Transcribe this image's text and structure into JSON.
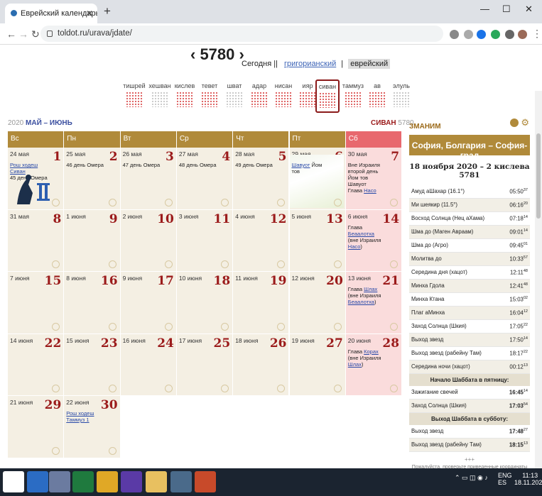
{
  "browser": {
    "tab_title": "Еврейский календарь и конвер",
    "url": "toldot.ru/urava/jdate/"
  },
  "year_nav": {
    "year": "‹ 5780 ›",
    "today": "Сегодня",
    "sep": "||",
    "gregorian": "григорианский",
    "sep2": "|",
    "hebrew": "еврейский"
  },
  "months": [
    "тишрей",
    "хешван",
    "кислев",
    "тевет",
    "шват",
    "адар",
    "нисан",
    "ияр",
    "сиван",
    "таммуз",
    "ав",
    "элуль"
  ],
  "month_header": {
    "g_year": "2020",
    "g_months": "МАЙ – ИЮНЬ",
    "h_month": "СИВАН",
    "h_year": "5780"
  },
  "weekdays": [
    "Вс",
    "Пн",
    "Вт",
    "Ср",
    "Чт",
    "Пт",
    "Сб"
  ],
  "weeks": [
    [
      {
        "d": "24 мая",
        "n": "1",
        "t": "Рош ходеш Сиван",
        "t2": "45 день Омера"
      },
      {
        "d": "25 мая",
        "n": "2",
        "t2": "46 день Омера"
      },
      {
        "d": "26 мая",
        "n": "3",
        "t2": "47 день Омера"
      },
      {
        "d": "27 мая",
        "n": "4",
        "t2": "48 день Омера"
      },
      {
        "d": "28 мая",
        "n": "5",
        "t2": "49 день Омера"
      },
      {
        "d": "29 мая",
        "n": "6",
        "t": "Шавуот",
        "t2": " Йом тов"
      },
      {
        "d": "30 мая",
        "n": "7",
        "t2": "Вне Израиля второй день Йом тов Шавуот",
        "t3": "Глава ",
        "t": "Насо"
      }
    ],
    [
      {
        "d": "31 мая",
        "n": "8"
      },
      {
        "d": "1 июня",
        "n": "9"
      },
      {
        "d": "2 июня",
        "n": "10"
      },
      {
        "d": "3 июня",
        "n": "11"
      },
      {
        "d": "4 июня",
        "n": "12"
      },
      {
        "d": "5 июня",
        "n": "13"
      },
      {
        "d": "6 июня",
        "n": "14",
        "t3": "Глава ",
        "t": "Беаалотха",
        "t4": "(вне Израиля ",
        "t5": "Насо",
        "t6": ")"
      }
    ],
    [
      {
        "d": "7 июня",
        "n": "15"
      },
      {
        "d": "8 июня",
        "n": "16"
      },
      {
        "d": "9 июня",
        "n": "17"
      },
      {
        "d": "10 июня",
        "n": "18"
      },
      {
        "d": "11 июня",
        "n": "19"
      },
      {
        "d": "12 июня",
        "n": "20"
      },
      {
        "d": "13 июня",
        "n": "21",
        "t3": "Глава ",
        "t": "Шлах",
        "t4": "(вне Израиля ",
        "t5": "Беаалотха",
        "t6": ")"
      }
    ],
    [
      {
        "d": "14 июня",
        "n": "22"
      },
      {
        "d": "15 июня",
        "n": "23"
      },
      {
        "d": "16 июня",
        "n": "24"
      },
      {
        "d": "17 июня",
        "n": "25"
      },
      {
        "d": "18 июня",
        "n": "26"
      },
      {
        "d": "19 июня",
        "n": "27"
      },
      {
        "d": "20 июня",
        "n": "28",
        "t3": "Глава ",
        "t": "Корах",
        "t4": "(вне Израиля ",
        "t5": "Шлах",
        "t6": ")"
      }
    ],
    [
      {
        "d": "21 июня",
        "n": "29"
      },
      {
        "d": "22 июня",
        "n": "30",
        "t": "Рош ходеш Таммуз 1"
      }
    ]
  ],
  "zmanim": {
    "title": "ЗМАНИМ",
    "location": "София, Болгария – София-град",
    "date": "18 ноября 2020 – 2 кислева 5781",
    "rows": [
      {
        "name": "Амуд аШахар (16.1°)",
        "time": "05:50",
        "sec": "37"
      },
      {
        "name": "Ми шеякир (11.5°)",
        "time": "06:16",
        "sec": "20"
      },
      {
        "name": "Восход Солнца (Нец аХама)",
        "time": "07:18",
        "sec": "14"
      },
      {
        "name": "Шма до (Маген Авраам)",
        "time": "09:01",
        "sec": "14"
      },
      {
        "name": "Шма до (Агро)",
        "time": "09:45",
        "sec": "01"
      },
      {
        "name": "Молитва до",
        "time": "10:33",
        "sec": "57"
      },
      {
        "name": "Середина дня (хацот)",
        "time": "12:11",
        "sec": "48"
      },
      {
        "name": "Минха Гдола",
        "time": "12:41",
        "sec": "48"
      },
      {
        "name": "Минха Ктана",
        "time": "15:03",
        "sec": "02"
      },
      {
        "name": "Плаг аМинха",
        "time": "16:04",
        "sec": "12"
      },
      {
        "name": "Заход Солнца (Шкия)",
        "time": "17:05",
        "sec": "22"
      },
      {
        "name": "Выход звезд",
        "time": "17:50",
        "sec": "14"
      },
      {
        "name": "Выход звезд (рабейну Там)",
        "time": "18:17",
        "sec": "22"
      },
      {
        "name": "Середина ночи (хацот)",
        "time": "00:12",
        "sec": "13"
      }
    ],
    "shabbat_start_title": "Начало Шаббата в пятницу:",
    "shabbat_start": [
      {
        "name": "Зажигание свечей",
        "time": "16:45",
        "sec": "14"
      },
      {
        "name": "Заход Солнца (Шкия)",
        "time": "17:03",
        "sec": "54"
      }
    ],
    "shabbat_end_title": "Выход Шаббата в субботу:",
    "shabbat_end": [
      {
        "name": "Выход звезд",
        "time": "17:48",
        "sec": "27"
      },
      {
        "name": "Выход звезд (рабейну Там)",
        "time": "18:15",
        "sec": "13"
      }
    ],
    "stars": "+++",
    "note": "Пожалуйста, проверьте приведенные координаты"
  },
  "taskbar": {
    "lang": "ENG",
    "lang2": "ES",
    "time": "11:13",
    "date": "18.11.2020"
  }
}
